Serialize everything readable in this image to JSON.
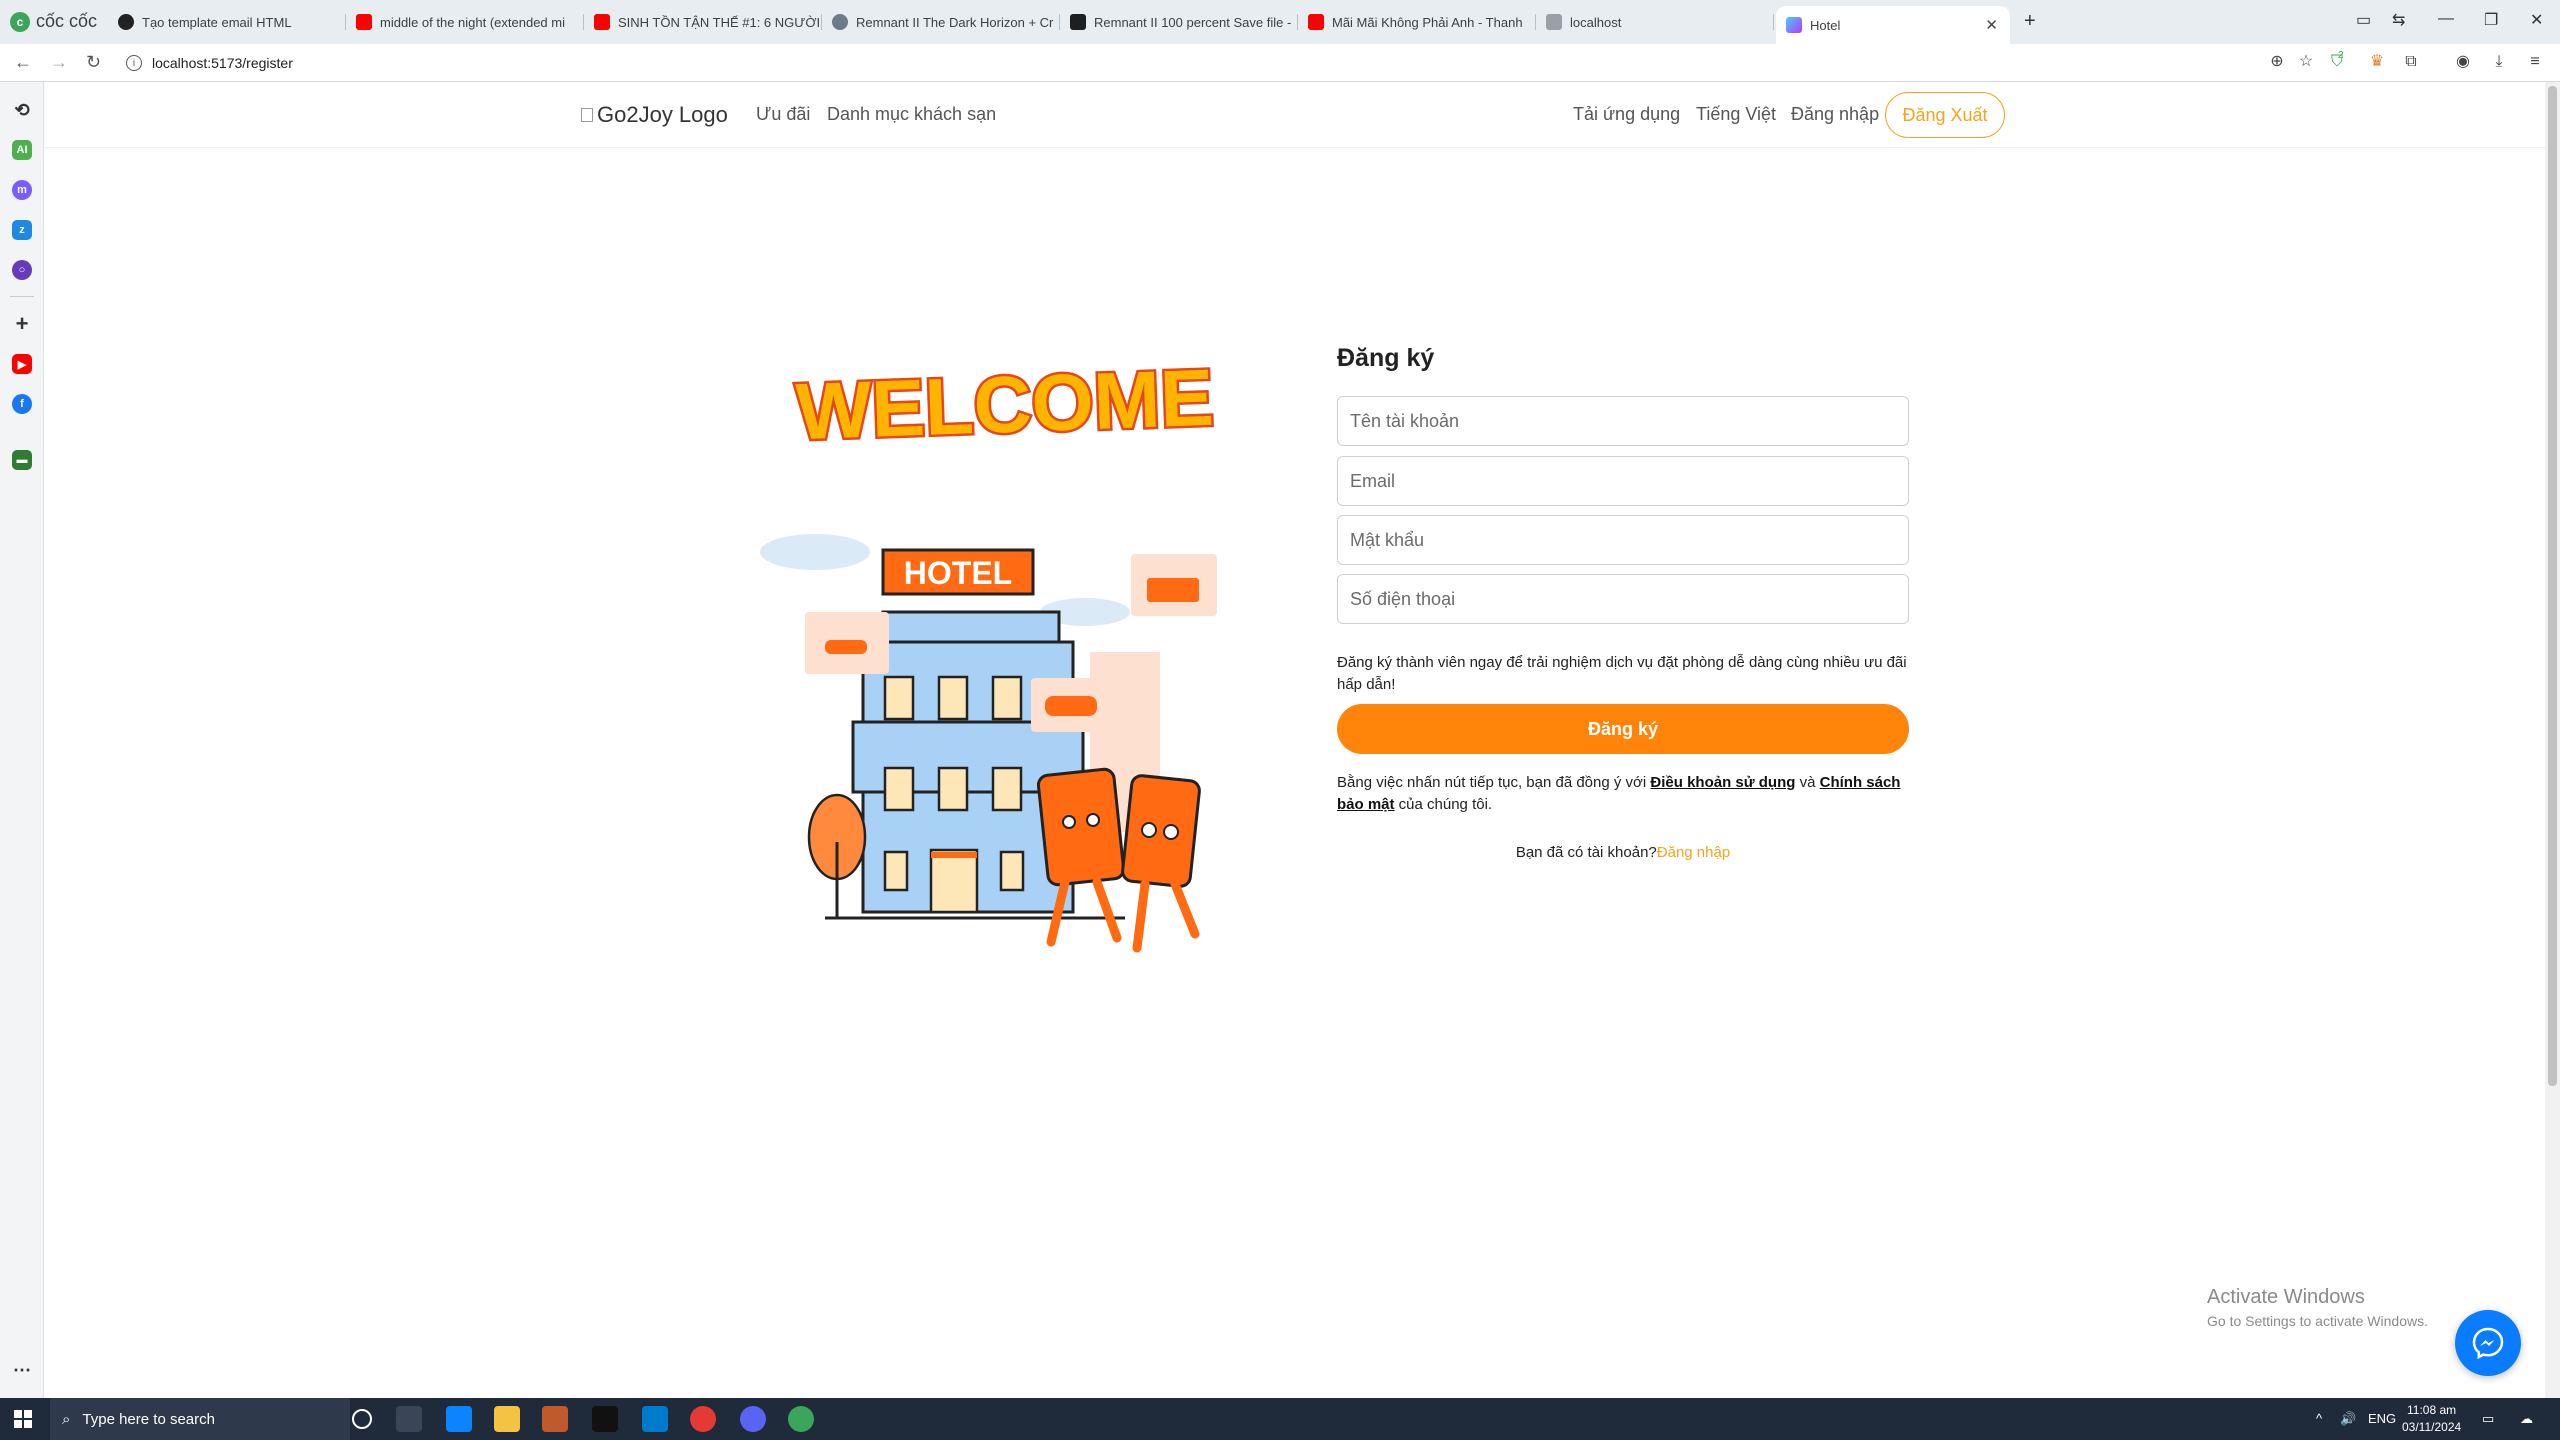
{
  "browser": {
    "brand": "cốc cốc",
    "tabs": [
      {
        "title": "Tạo template email HTML",
        "color": "#222"
      },
      {
        "title": "middle of the night (extended mi",
        "color": "#ff0000"
      },
      {
        "title": "SINH TỒN TẬN THẾ #1: 6 NGƯỜI",
        "color": "#ff0000"
      },
      {
        "title": "Remnant II The Dark Horizon + Cr",
        "color": "#6c7a89"
      },
      {
        "title": "Remnant II 100 percent Save file -",
        "color": "#1f1f1f"
      },
      {
        "title": "Mãi Mãi Không Phải Anh - Thanh",
        "color": "#ff0000"
      },
      {
        "title": "localhost",
        "color": "#9aa0a6"
      },
      {
        "title": "Hotel",
        "color": "#8e44ad"
      }
    ],
    "url": "localhost:5173/register",
    "extension_badge": "2"
  },
  "header": {
    "logo_alt": "Go2Joy Logo",
    "nav_left": [
      "Ưu đãi",
      "Danh mục khách sạn"
    ],
    "nav_right": [
      "Tải ứng dụng",
      "Tiếng Việt",
      "Đăng nhập"
    ],
    "logout_label": "Đăng Xuất"
  },
  "illustration": {
    "welcome": "WELCOME",
    "hotel_sign": "HOTEL"
  },
  "form": {
    "title": "Đăng ký",
    "username_placeholder": "Tên tài khoản",
    "email_placeholder": "Email",
    "password_placeholder": "Mật khẩu",
    "phone_placeholder": "Số điện thoại",
    "promo_note": "Đăng ký thành viên ngay để trải nghiệm dịch vụ đặt phòng dễ dàng cùng nhiều ưu đãi hấp dẫn!",
    "submit_label": "Đăng ký",
    "terms_prefix": "Bằng việc nhấn nút tiếp tục, bạn đã đồng ý với ",
    "terms_link": "Điều khoản sử dụng",
    "terms_and": " và ",
    "privacy_link": "Chính sách bảo mật",
    "terms_suffix": " của chúng tôi.",
    "have_account": "Bạn đã có tài khoản?",
    "login_link": "Đăng nhập"
  },
  "watermark": {
    "title": "Activate Windows",
    "subtitle": "Go to Settings to activate Windows."
  },
  "taskbar": {
    "search_placeholder": "Type here to search",
    "language": "ENG",
    "time": "11:08 am",
    "date": "03/11/2024"
  },
  "colors": {
    "accent": "#ff8409",
    "link": "#f7a21b"
  }
}
